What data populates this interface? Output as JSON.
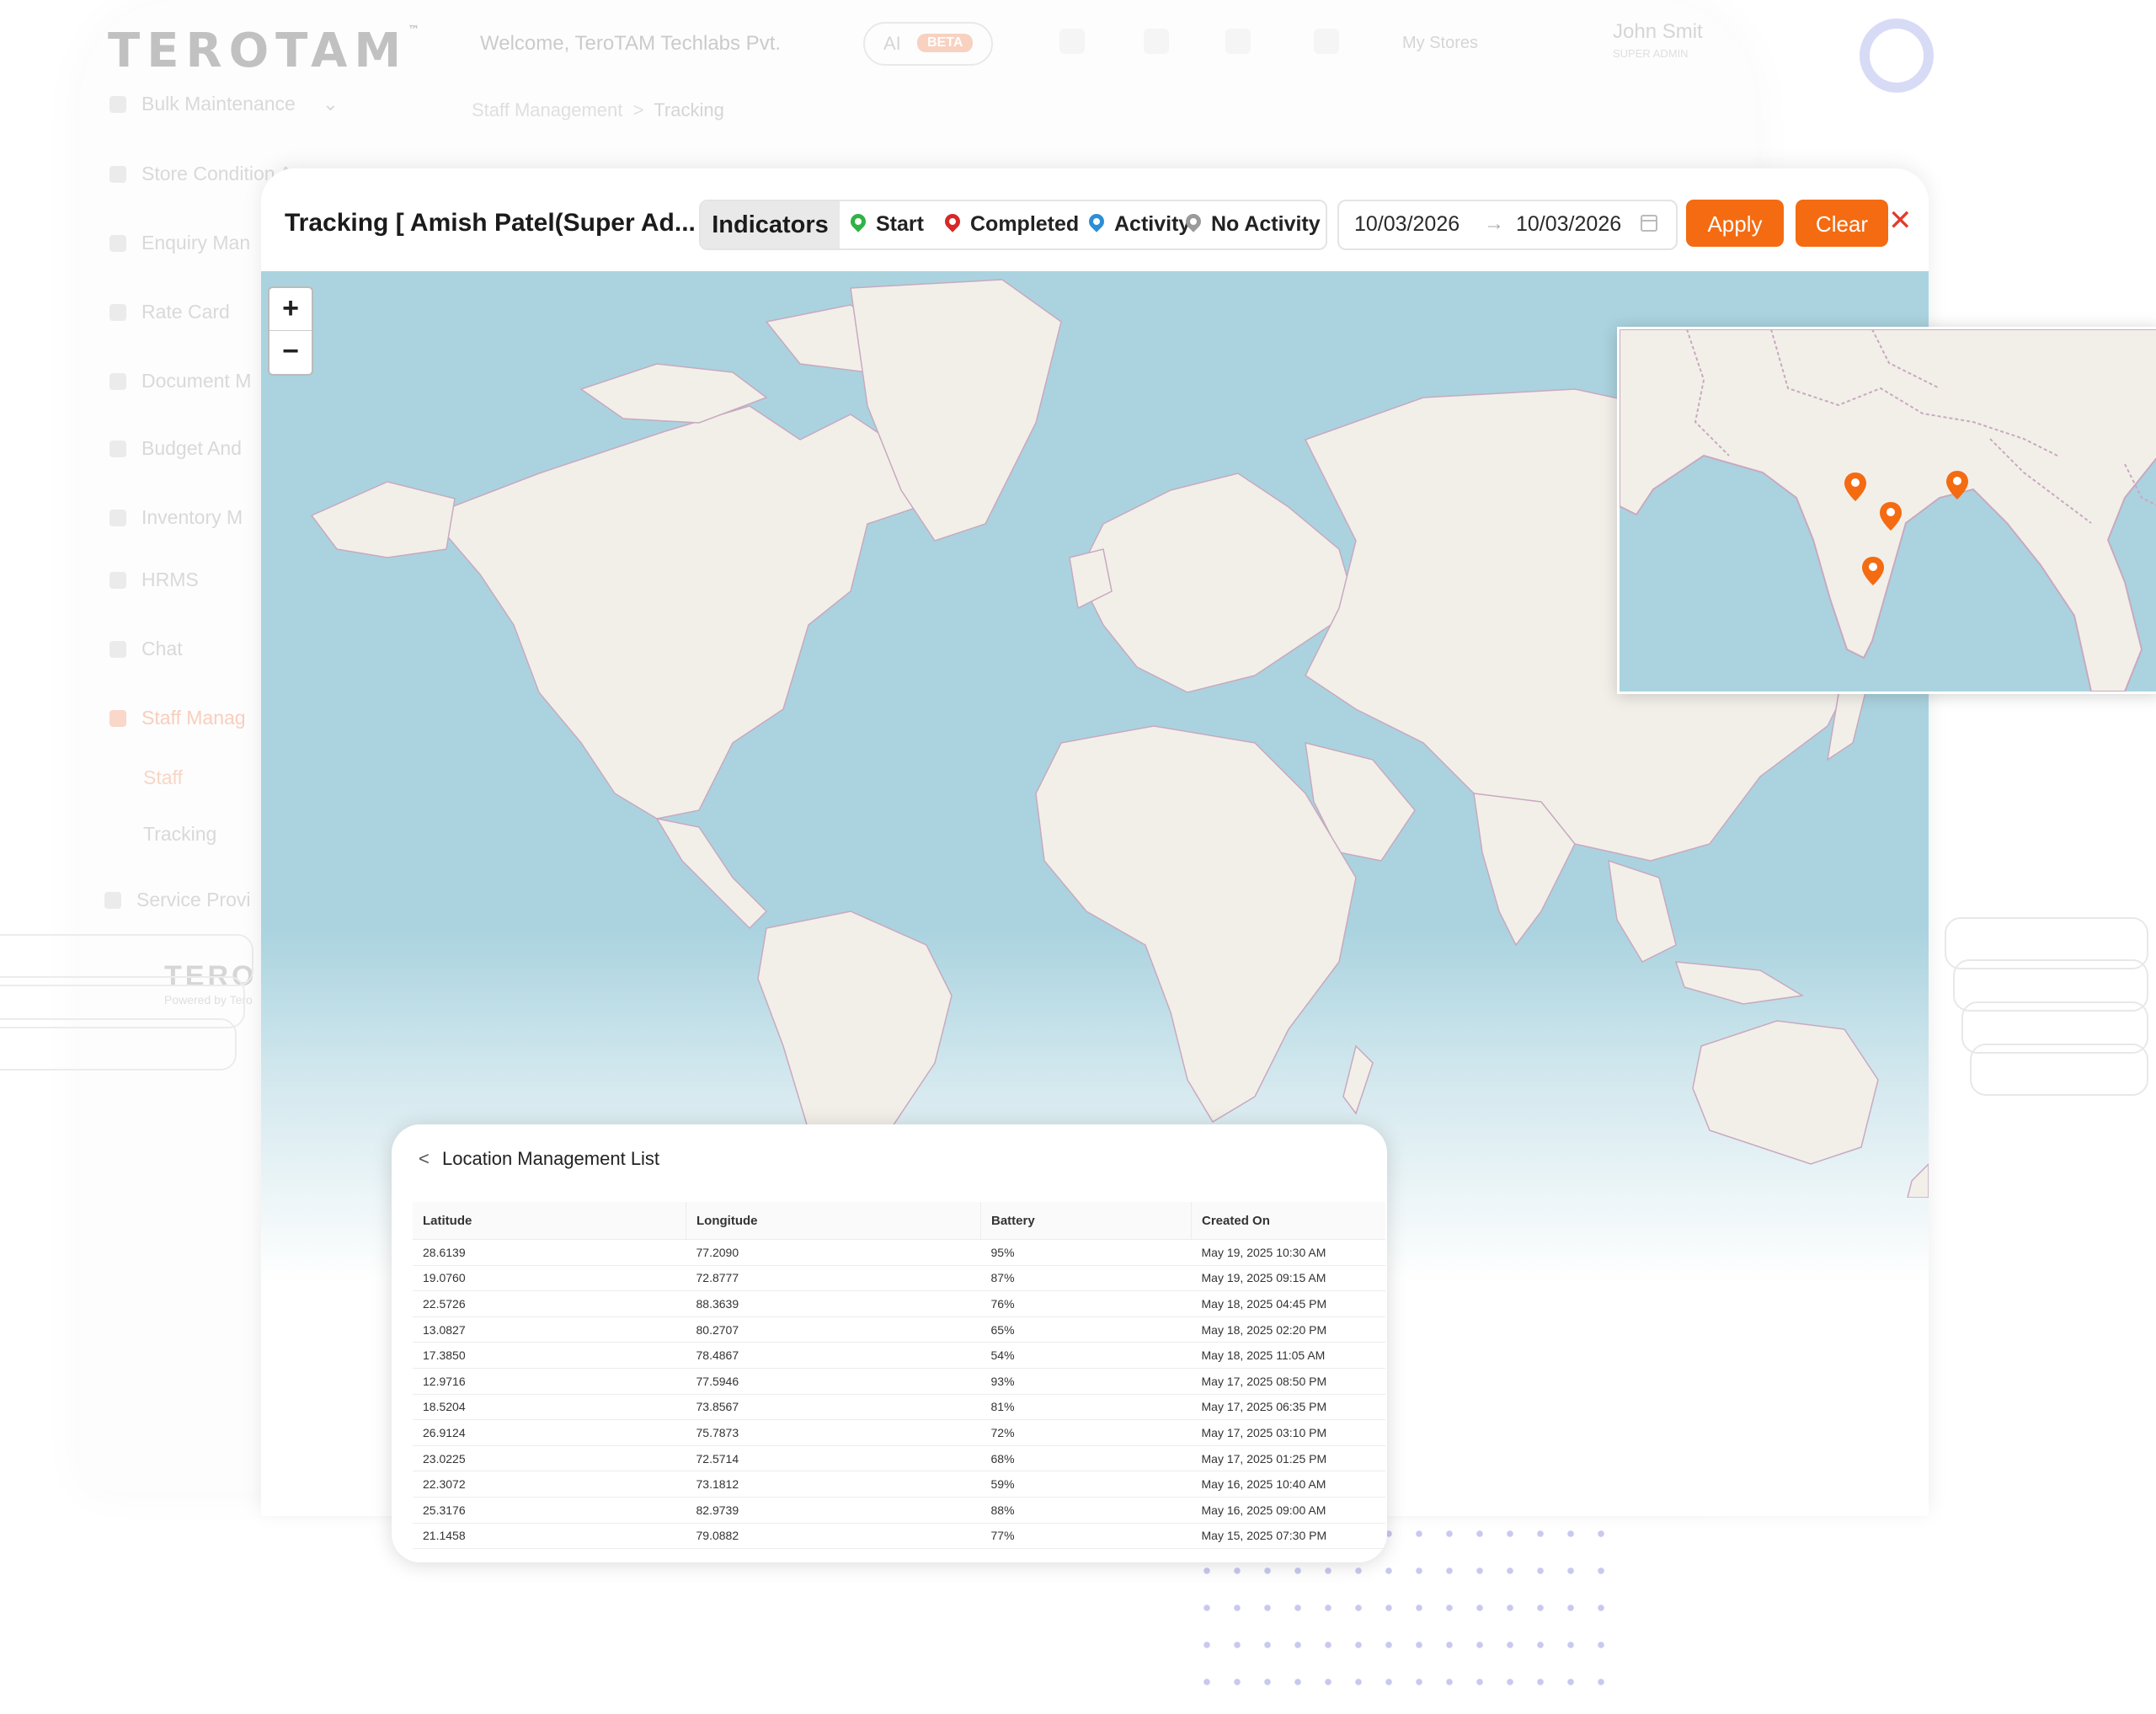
{
  "background_app": {
    "logo": "TEROTAM",
    "welcome": "Welcome, TeroTAM Techlabs Pvt.",
    "ai_label": "AI",
    "ai_badge": "BETA",
    "my_stores": "My Stores",
    "user_name": "John Smit",
    "user_role": "SUPER ADMIN",
    "breadcrumb": [
      "Staff Management",
      "Tracking"
    ],
    "sidebar": [
      {
        "label": "Bulk Maintenance"
      },
      {
        "label": "Store Condition As"
      },
      {
        "label": "Enquiry Man"
      },
      {
        "label": "Rate Card"
      },
      {
        "label": "Document M"
      },
      {
        "label": "Budget And"
      },
      {
        "label": "Inventory M"
      },
      {
        "label": "HRMS"
      },
      {
        "label": "Chat"
      },
      {
        "label": "Staff Manag"
      },
      {
        "label": "Staff"
      },
      {
        "label": "Tracking"
      },
      {
        "label": "Service Provi"
      }
    ],
    "footer_logo": "TERO",
    "footer_powered": "Powered by Tero"
  },
  "toolbar": {
    "title": "Tracking [ Amish Patel(Super Ad...",
    "indicators_label": "Indicators",
    "indicators": [
      {
        "label": "Start",
        "color": "#2fb344"
      },
      {
        "label": "Completed",
        "color": "#d62828"
      },
      {
        "label": "Activity",
        "color": "#2b8fd6"
      },
      {
        "label": "No Activity",
        "color": "#9a9a9a"
      }
    ],
    "date_from": "10/03/2026",
    "date_to": "10/03/2026",
    "apply_label": "Apply",
    "clear_label": "Clear",
    "close_symbol": "✕"
  },
  "map": {
    "zoom_in": "+",
    "zoom_out": "−"
  },
  "location_list": {
    "title": "Location Management List",
    "columns": [
      "Latitude",
      "Longitude",
      "Battery",
      "Created On"
    ],
    "rows": [
      [
        "28.6139",
        "77.2090",
        "95%",
        "May 19, 2025 10:30 AM"
      ],
      [
        "19.0760",
        "72.8777",
        "87%",
        "May 19, 2025 09:15 AM"
      ],
      [
        "22.5726",
        "88.3639",
        "76%",
        "May 18, 2025 04:45 PM"
      ],
      [
        "13.0827",
        "80.2707",
        "65%",
        "May 18, 2025 02:20 PM"
      ],
      [
        "17.3850",
        "78.4867",
        "54%",
        "May 18, 2025 11:05 AM"
      ],
      [
        "12.9716",
        "77.5946",
        "93%",
        "May 17, 2025 08:50 PM"
      ],
      [
        "18.5204",
        "73.8567",
        "81%",
        "May 17, 2025 06:35 PM"
      ],
      [
        "26.9124",
        "75.7873",
        "72%",
        "May 17, 2025 03:10 PM"
      ],
      [
        "23.0225",
        "72.5714",
        "68%",
        "May 17, 2025 01:25 PM"
      ],
      [
        "22.3072",
        "73.1812",
        "59%",
        "May 16, 2025 10:40 AM"
      ],
      [
        "25.3176",
        "82.9739",
        "88%",
        "May 16, 2025 09:00 AM"
      ],
      [
        "21.1458",
        "79.0882",
        "77%",
        "May 15, 2025 07:30 PM"
      ]
    ]
  },
  "colors": {
    "accent": "#f46b12",
    "water": "#aad3df",
    "land": "#f2efe9"
  }
}
